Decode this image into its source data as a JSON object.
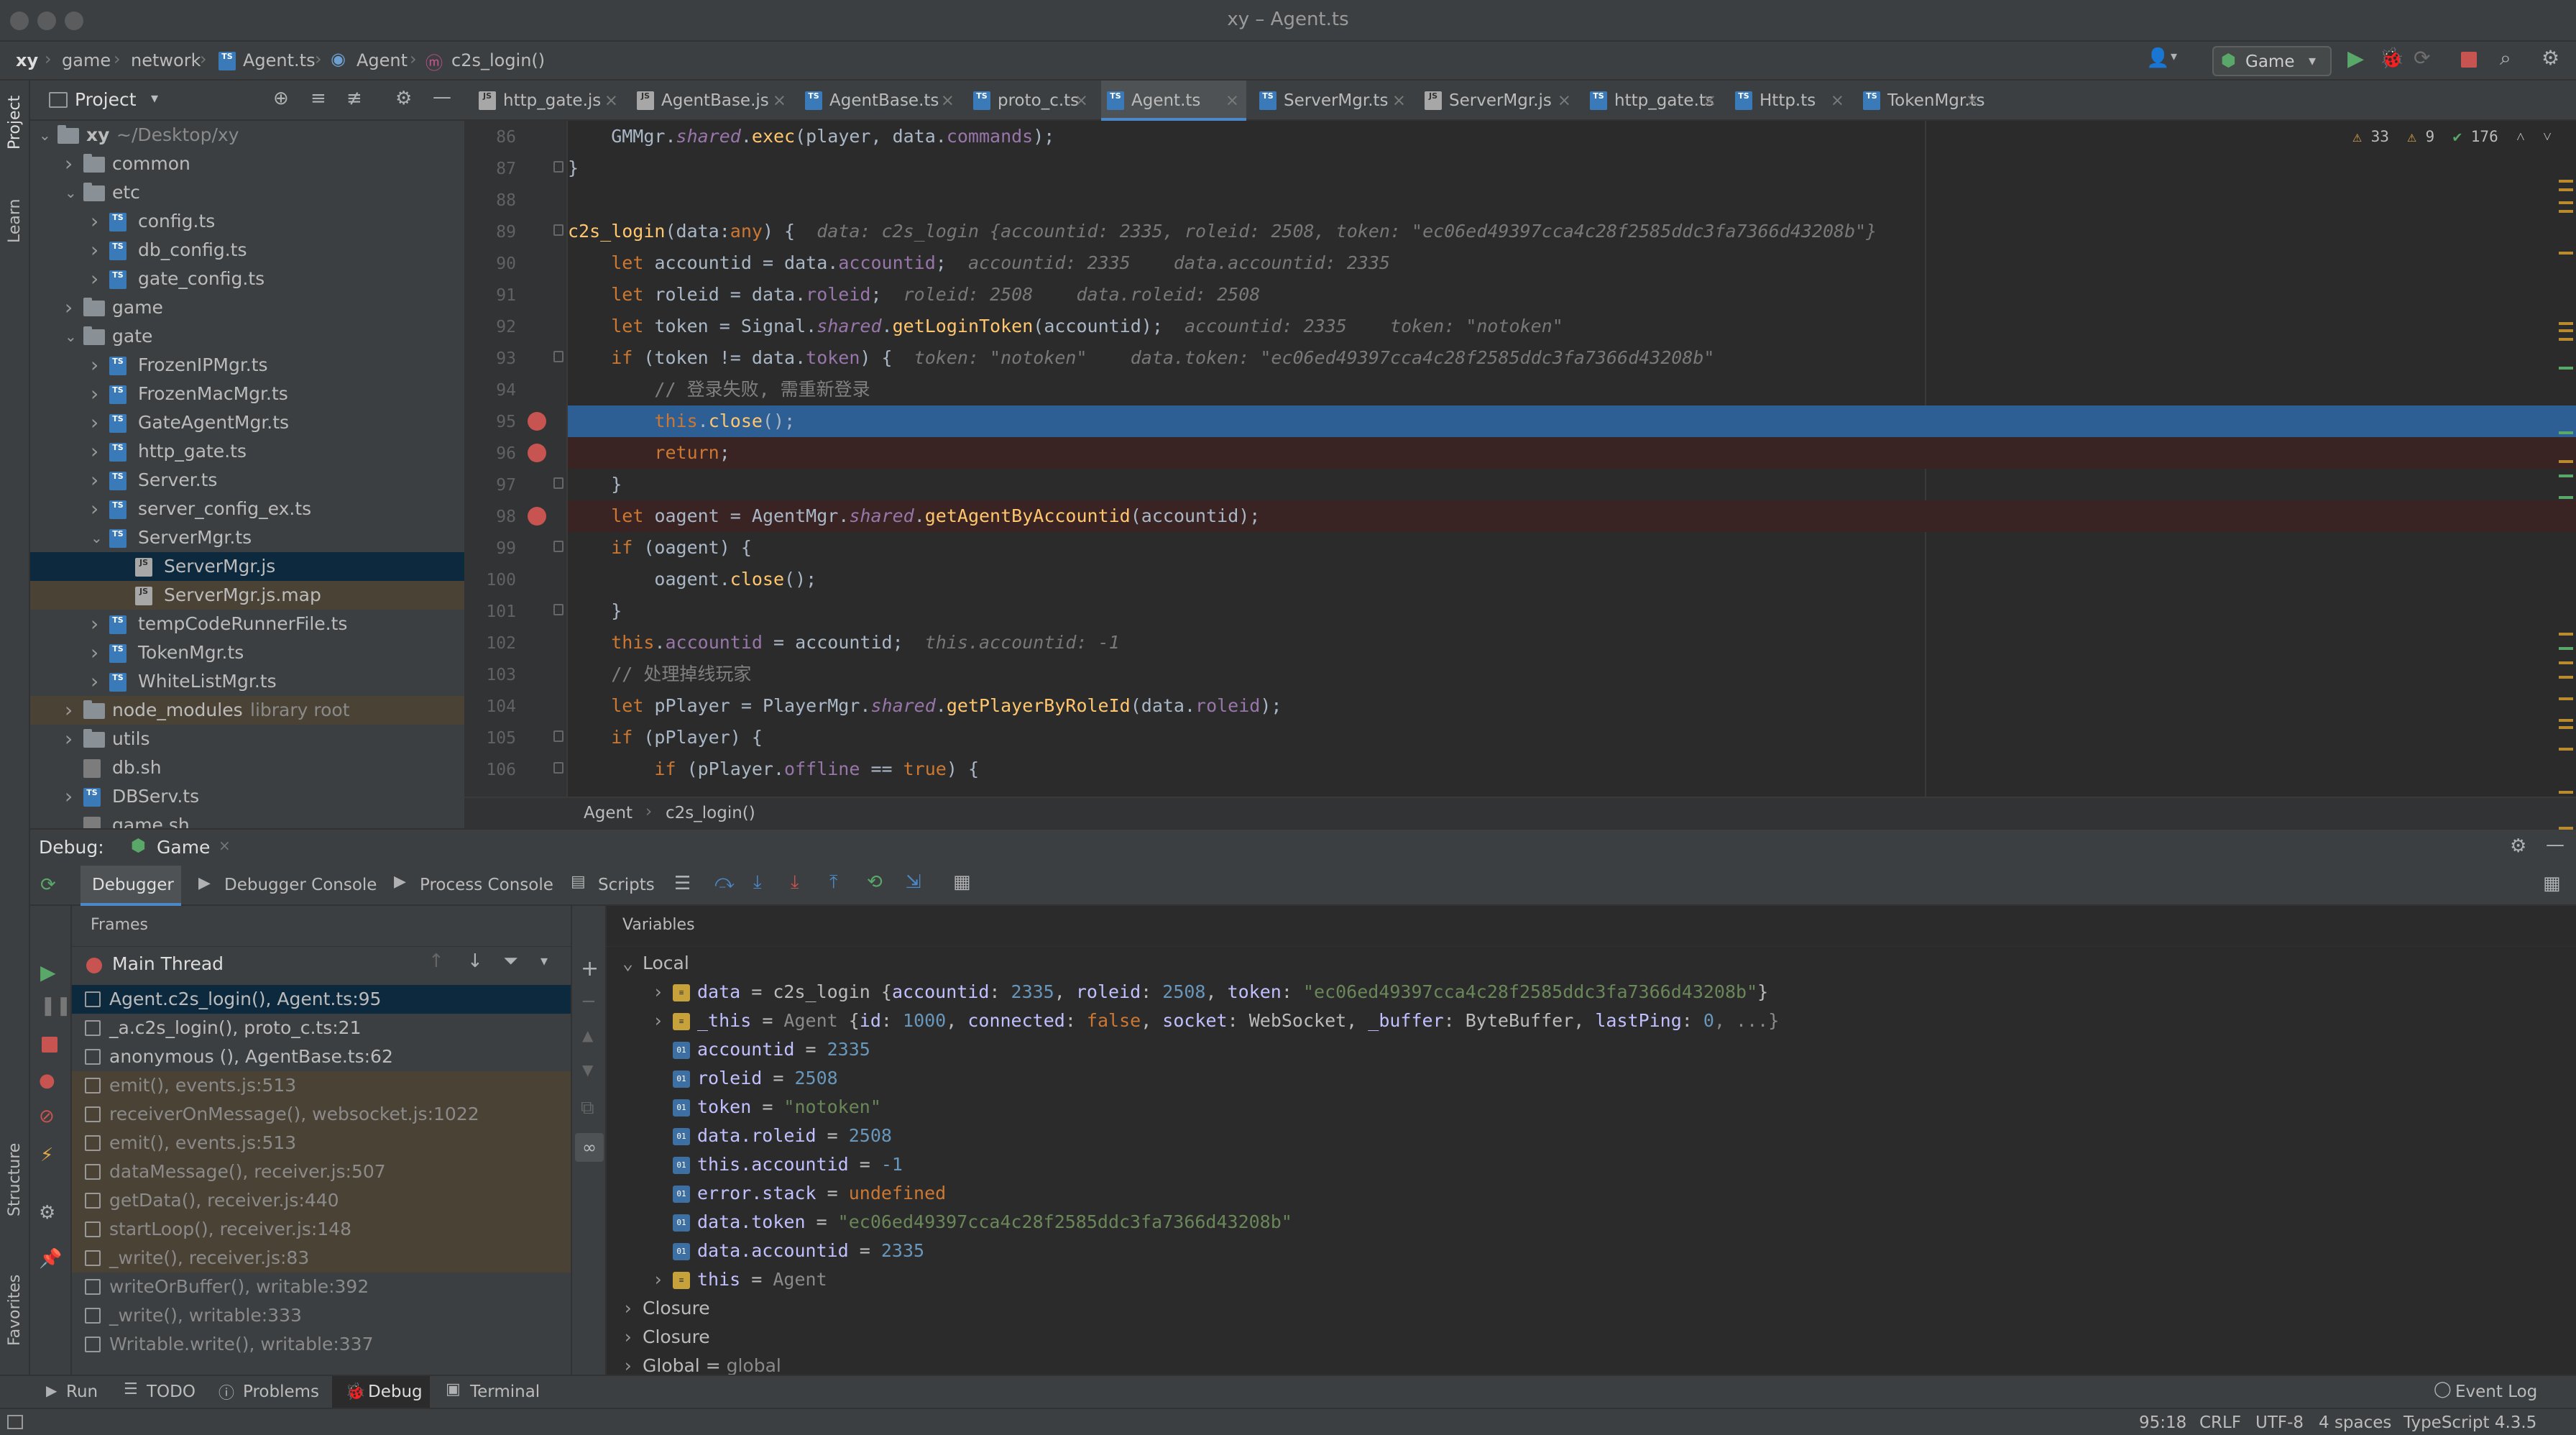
{
  "window": {
    "title": "xy – Agent.ts"
  },
  "breadcrumbs": [
    "xy",
    "game",
    "network",
    "Agent.ts",
    "Agent",
    "c2s_login()"
  ],
  "run_config": {
    "label": "Game"
  },
  "project_panel": {
    "title": "Project",
    "tree": [
      {
        "label": "xy",
        "hint": "~/Desktop/xy",
        "type": "folder",
        "depth": 0,
        "expanded": true
      },
      {
        "label": "common",
        "type": "folder",
        "depth": 1,
        "expanded": false
      },
      {
        "label": "etc",
        "type": "folder",
        "depth": 1,
        "expanded": true
      },
      {
        "label": "config.ts",
        "type": "ts",
        "depth": 2,
        "expanded": false
      },
      {
        "label": "db_config.ts",
        "type": "ts",
        "depth": 2,
        "expanded": false
      },
      {
        "label": "gate_config.ts",
        "type": "ts",
        "depth": 2,
        "expanded": false
      },
      {
        "label": "game",
        "type": "folder",
        "depth": 1,
        "expanded": false
      },
      {
        "label": "gate",
        "type": "folder",
        "depth": 1,
        "expanded": true
      },
      {
        "label": "FrozenIPMgr.ts",
        "type": "ts",
        "depth": 2,
        "expanded": false
      },
      {
        "label": "FrozenMacMgr.ts",
        "type": "ts",
        "depth": 2,
        "expanded": false
      },
      {
        "label": "GateAgentMgr.ts",
        "type": "ts",
        "depth": 2,
        "expanded": false
      },
      {
        "label": "http_gate.ts",
        "type": "ts",
        "depth": 2,
        "expanded": false
      },
      {
        "label": "Server.ts",
        "type": "ts",
        "depth": 2,
        "expanded": false
      },
      {
        "label": "server_config_ex.ts",
        "type": "ts",
        "depth": 2,
        "expanded": false
      },
      {
        "label": "ServerMgr.ts",
        "type": "ts",
        "depth": 2,
        "expanded": true
      },
      {
        "label": "ServerMgr.js",
        "type": "js",
        "depth": 3,
        "state": "selected"
      },
      {
        "label": "ServerMgr.js.map",
        "type": "js",
        "depth": 3,
        "state": "lib"
      },
      {
        "label": "tempCodeRunnerFile.ts",
        "type": "ts",
        "depth": 2,
        "expanded": false
      },
      {
        "label": "TokenMgr.ts",
        "type": "ts",
        "depth": 2,
        "expanded": false
      },
      {
        "label": "WhiteListMgr.ts",
        "type": "ts",
        "depth": 2,
        "expanded": false
      },
      {
        "label": "node_modules",
        "hint": "library root",
        "type": "folder",
        "depth": 1,
        "expanded": false,
        "state": "lib"
      },
      {
        "label": "utils",
        "type": "folder",
        "depth": 1,
        "expanded": false
      },
      {
        "label": "db.sh",
        "type": "file",
        "depth": 1
      },
      {
        "label": "DBServ.ts",
        "type": "ts",
        "depth": 1,
        "expanded": false
      },
      {
        "label": "game.sh",
        "type": "file",
        "depth": 1
      }
    ]
  },
  "editor_tabs": [
    "http_gate.js",
    "AgentBase.js",
    "AgentBase.ts",
    "proto_c.ts",
    "Agent.ts",
    "ServerMgr.ts",
    "ServerMgr.js",
    "http_gate.ts",
    "Http.ts",
    "TokenMgr.ts"
  ],
  "active_tab": "Agent.ts",
  "inspections": {
    "warnings": "33",
    "weak": "9",
    "ok": "176"
  },
  "code": {
    "line_numbers": [
      "86",
      "87",
      "88",
      "89",
      "90",
      "91",
      "92",
      "93",
      "94",
      "95",
      "96",
      "97",
      "98",
      "99",
      "100",
      "101",
      "102",
      "103",
      "104",
      "105",
      "106"
    ],
    "breadcrumb": [
      "Agent",
      "c2s_login()"
    ]
  },
  "debug": {
    "label": "Debug:",
    "session": "Game",
    "tabs": [
      "Debugger",
      "Debugger Console",
      "Process Console",
      "Scripts"
    ],
    "frames_label": "Frames",
    "thread": "Main Thread",
    "variables_label": "Variables",
    "frames": [
      {
        "text": "Agent.c2s_login(), Agent.ts:95",
        "state": "selected"
      },
      {
        "text": "_a.c2s_login(), proto_c.ts:21",
        "state": "normal"
      },
      {
        "text": "anonymous (), AgentBase.ts:62",
        "state": "normal"
      },
      {
        "text": "emit(), events.js:513",
        "state": "lib"
      },
      {
        "text": "receiverOnMessage(), websocket.js:1022",
        "state": "lib"
      },
      {
        "text": "emit(), events.js:513",
        "state": "lib"
      },
      {
        "text": "dataMessage(), receiver.js:507",
        "state": "lib"
      },
      {
        "text": "getData(), receiver.js:440",
        "state": "lib"
      },
      {
        "text": "startLoop(), receiver.js:148",
        "state": "lib"
      },
      {
        "text": "_write(), receiver.js:83",
        "state": "lib"
      },
      {
        "text": "writeOrBuffer(), writable:392",
        "state": "dim"
      },
      {
        "text": "_write(), writable:333",
        "state": "dim"
      },
      {
        "text": "Writable.write(), writable:337",
        "state": "dim"
      }
    ],
    "variables": {
      "local_label": "Local",
      "closure_labels": [
        "Closure",
        "Closure"
      ],
      "global": {
        "name": "Global",
        "value": "global"
      }
    }
  },
  "bottom_tabs": [
    "Run",
    "TODO",
    "Problems",
    "Debug",
    "Terminal"
  ],
  "event_log": "Event Log",
  "status": {
    "position": "95:18",
    "line_sep": "CRLF",
    "encoding": "UTF-8",
    "indent": "4 spaces",
    "lang": "TypeScript 4.3.5"
  },
  "colors": {
    "accent": "#4a88c7",
    "breakpoint": "#c75450",
    "exec_line": "#2d5e94",
    "library": "#4b4236"
  }
}
